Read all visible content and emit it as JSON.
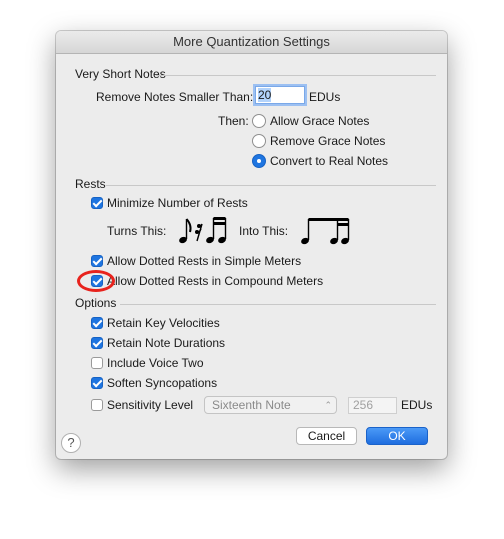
{
  "dialog": {
    "title": "More Quantization Settings",
    "help_label": "?"
  },
  "very_short_notes": {
    "heading": "Very Short Notes",
    "remove_label": "Remove Notes Smaller Than:",
    "remove_value": "20",
    "remove_unit": "EDUs",
    "then_label": "Then:",
    "options": [
      {
        "label": "Allow Grace Notes",
        "selected": false
      },
      {
        "label": "Remove Grace Notes",
        "selected": false
      },
      {
        "label": "Convert to Real Notes",
        "selected": true
      }
    ]
  },
  "rests": {
    "heading": "Rests",
    "minimize": {
      "label": "Minimize Number of Rests",
      "checked": true
    },
    "turns_this_label": "Turns This:",
    "into_this_label": "Into This:",
    "dotted_simple": {
      "label": "Allow Dotted Rests in Simple Meters",
      "checked": true
    },
    "dotted_compound": {
      "label": "Allow Dotted Rests in Compound Meters",
      "checked": true
    }
  },
  "options": {
    "heading": "Options",
    "retain_key_velocities": {
      "label": "Retain Key Velocities",
      "checked": true
    },
    "retain_note_durations": {
      "label": "Retain Note Durations",
      "checked": true
    },
    "include_voice_two": {
      "label": "Include Voice Two",
      "checked": false
    },
    "soften_syncopations": {
      "label": "Soften Syncopations",
      "checked": true
    },
    "sensitivity_level": {
      "label": "Sensitivity Level",
      "checked": false
    },
    "sensitivity_select": "Sixteenth Note",
    "sensitivity_value": "256",
    "sensitivity_unit": "EDUs"
  },
  "buttons": {
    "cancel": "Cancel",
    "ok": "OK"
  },
  "colors": {
    "accent": "#1f75e0",
    "annotation": "#e8231d"
  }
}
